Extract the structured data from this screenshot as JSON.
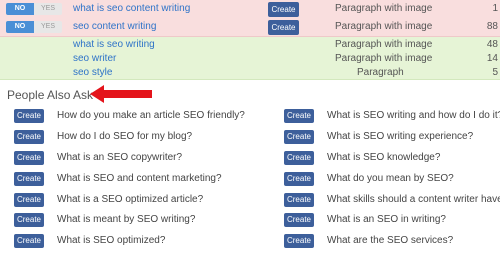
{
  "keyword_rows": [
    {
      "toggle_no": "NO",
      "toggle_yes": "YES",
      "keyword": "what is seo content writing",
      "create_label": "Create",
      "type": "Paragraph with image",
      "count": "1"
    },
    {
      "toggle_no": "NO",
      "toggle_yes": "YES",
      "keyword": "seo content writing",
      "create_label": "Create",
      "type": "Paragraph with image",
      "count": "88"
    }
  ],
  "related_rows": [
    {
      "keyword": "what is seo writing",
      "type": "Paragraph with image",
      "count": "48"
    },
    {
      "keyword": "seo writer",
      "type": "Paragraph with image",
      "count": "14"
    },
    {
      "keyword": "seo style",
      "type": "Paragraph",
      "count": "5"
    }
  ],
  "paa": {
    "title": "People Also Ask",
    "create_label": "Create",
    "left_questions": [
      "How do you make an article SEO friendly?",
      "How do I do SEO for my blog?",
      "What is an SEO copywriter?",
      "What is SEO and content marketing?",
      "What is a SEO optimized article?",
      "What is meant by SEO writing?",
      "What is SEO optimized?"
    ],
    "right_questions": [
      "What is SEO writing and how do I do it?",
      "What is SEO writing experience?",
      "What is SEO knowledge?",
      "What do you mean by SEO?",
      "What skills should a content writer have?",
      "What is an SEO in writing?",
      "What are the SEO services?"
    ]
  },
  "colors": {
    "accent_blue": "#4a8fd6",
    "create_button": "#3d5f9b",
    "red_row_bg": "#f9dede",
    "green_row_bg": "#e6f4d6",
    "arrow": "#e4141b"
  }
}
